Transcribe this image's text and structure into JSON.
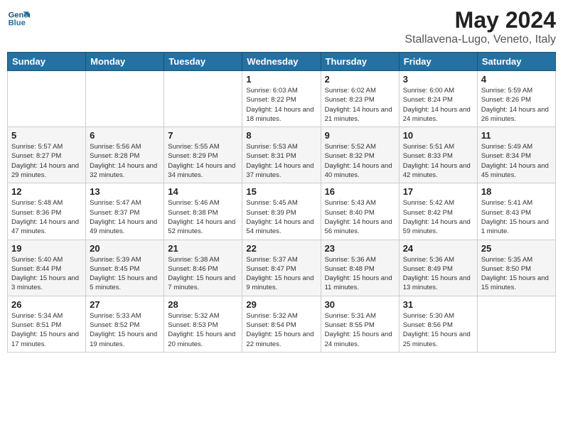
{
  "logo": {
    "line1": "General",
    "line2": "Blue"
  },
  "title": "May 2024",
  "subtitle": "Stallavena-Lugo, Veneto, Italy",
  "weekdays": [
    "Sunday",
    "Monday",
    "Tuesday",
    "Wednesday",
    "Thursday",
    "Friday",
    "Saturday"
  ],
  "weeks": [
    [
      {
        "day": "",
        "info": ""
      },
      {
        "day": "",
        "info": ""
      },
      {
        "day": "",
        "info": ""
      },
      {
        "day": "1",
        "info": "Sunrise: 6:03 AM\nSunset: 8:22 PM\nDaylight: 14 hours\nand 18 minutes."
      },
      {
        "day": "2",
        "info": "Sunrise: 6:02 AM\nSunset: 8:23 PM\nDaylight: 14 hours\nand 21 minutes."
      },
      {
        "day": "3",
        "info": "Sunrise: 6:00 AM\nSunset: 8:24 PM\nDaylight: 14 hours\nand 24 minutes."
      },
      {
        "day": "4",
        "info": "Sunrise: 5:59 AM\nSunset: 8:26 PM\nDaylight: 14 hours\nand 26 minutes."
      }
    ],
    [
      {
        "day": "5",
        "info": "Sunrise: 5:57 AM\nSunset: 8:27 PM\nDaylight: 14 hours\nand 29 minutes."
      },
      {
        "day": "6",
        "info": "Sunrise: 5:56 AM\nSunset: 8:28 PM\nDaylight: 14 hours\nand 32 minutes."
      },
      {
        "day": "7",
        "info": "Sunrise: 5:55 AM\nSunset: 8:29 PM\nDaylight: 14 hours\nand 34 minutes."
      },
      {
        "day": "8",
        "info": "Sunrise: 5:53 AM\nSunset: 8:31 PM\nDaylight: 14 hours\nand 37 minutes."
      },
      {
        "day": "9",
        "info": "Sunrise: 5:52 AM\nSunset: 8:32 PM\nDaylight: 14 hours\nand 40 minutes."
      },
      {
        "day": "10",
        "info": "Sunrise: 5:51 AM\nSunset: 8:33 PM\nDaylight: 14 hours\nand 42 minutes."
      },
      {
        "day": "11",
        "info": "Sunrise: 5:49 AM\nSunset: 8:34 PM\nDaylight: 14 hours\nand 45 minutes."
      }
    ],
    [
      {
        "day": "12",
        "info": "Sunrise: 5:48 AM\nSunset: 8:36 PM\nDaylight: 14 hours\nand 47 minutes."
      },
      {
        "day": "13",
        "info": "Sunrise: 5:47 AM\nSunset: 8:37 PM\nDaylight: 14 hours\nand 49 minutes."
      },
      {
        "day": "14",
        "info": "Sunrise: 5:46 AM\nSunset: 8:38 PM\nDaylight: 14 hours\nand 52 minutes."
      },
      {
        "day": "15",
        "info": "Sunrise: 5:45 AM\nSunset: 8:39 PM\nDaylight: 14 hours\nand 54 minutes."
      },
      {
        "day": "16",
        "info": "Sunrise: 5:43 AM\nSunset: 8:40 PM\nDaylight: 14 hours\nand 56 minutes."
      },
      {
        "day": "17",
        "info": "Sunrise: 5:42 AM\nSunset: 8:42 PM\nDaylight: 14 hours\nand 59 minutes."
      },
      {
        "day": "18",
        "info": "Sunrise: 5:41 AM\nSunset: 8:43 PM\nDaylight: 15 hours\nand 1 minute."
      }
    ],
    [
      {
        "day": "19",
        "info": "Sunrise: 5:40 AM\nSunset: 8:44 PM\nDaylight: 15 hours\nand 3 minutes."
      },
      {
        "day": "20",
        "info": "Sunrise: 5:39 AM\nSunset: 8:45 PM\nDaylight: 15 hours\nand 5 minutes."
      },
      {
        "day": "21",
        "info": "Sunrise: 5:38 AM\nSunset: 8:46 PM\nDaylight: 15 hours\nand 7 minutes."
      },
      {
        "day": "22",
        "info": "Sunrise: 5:37 AM\nSunset: 8:47 PM\nDaylight: 15 hours\nand 9 minutes."
      },
      {
        "day": "23",
        "info": "Sunrise: 5:36 AM\nSunset: 8:48 PM\nDaylight: 15 hours\nand 11 minutes."
      },
      {
        "day": "24",
        "info": "Sunrise: 5:36 AM\nSunset: 8:49 PM\nDaylight: 15 hours\nand 13 minutes."
      },
      {
        "day": "25",
        "info": "Sunrise: 5:35 AM\nSunset: 8:50 PM\nDaylight: 15 hours\nand 15 minutes."
      }
    ],
    [
      {
        "day": "26",
        "info": "Sunrise: 5:34 AM\nSunset: 8:51 PM\nDaylight: 15 hours\nand 17 minutes."
      },
      {
        "day": "27",
        "info": "Sunrise: 5:33 AM\nSunset: 8:52 PM\nDaylight: 15 hours\nand 19 minutes."
      },
      {
        "day": "28",
        "info": "Sunrise: 5:32 AM\nSunset: 8:53 PM\nDaylight: 15 hours\nand 20 minutes."
      },
      {
        "day": "29",
        "info": "Sunrise: 5:32 AM\nSunset: 8:54 PM\nDaylight: 15 hours\nand 22 minutes."
      },
      {
        "day": "30",
        "info": "Sunrise: 5:31 AM\nSunset: 8:55 PM\nDaylight: 15 hours\nand 24 minutes."
      },
      {
        "day": "31",
        "info": "Sunrise: 5:30 AM\nSunset: 8:56 PM\nDaylight: 15 hours\nand 25 minutes."
      },
      {
        "day": "",
        "info": ""
      }
    ]
  ]
}
